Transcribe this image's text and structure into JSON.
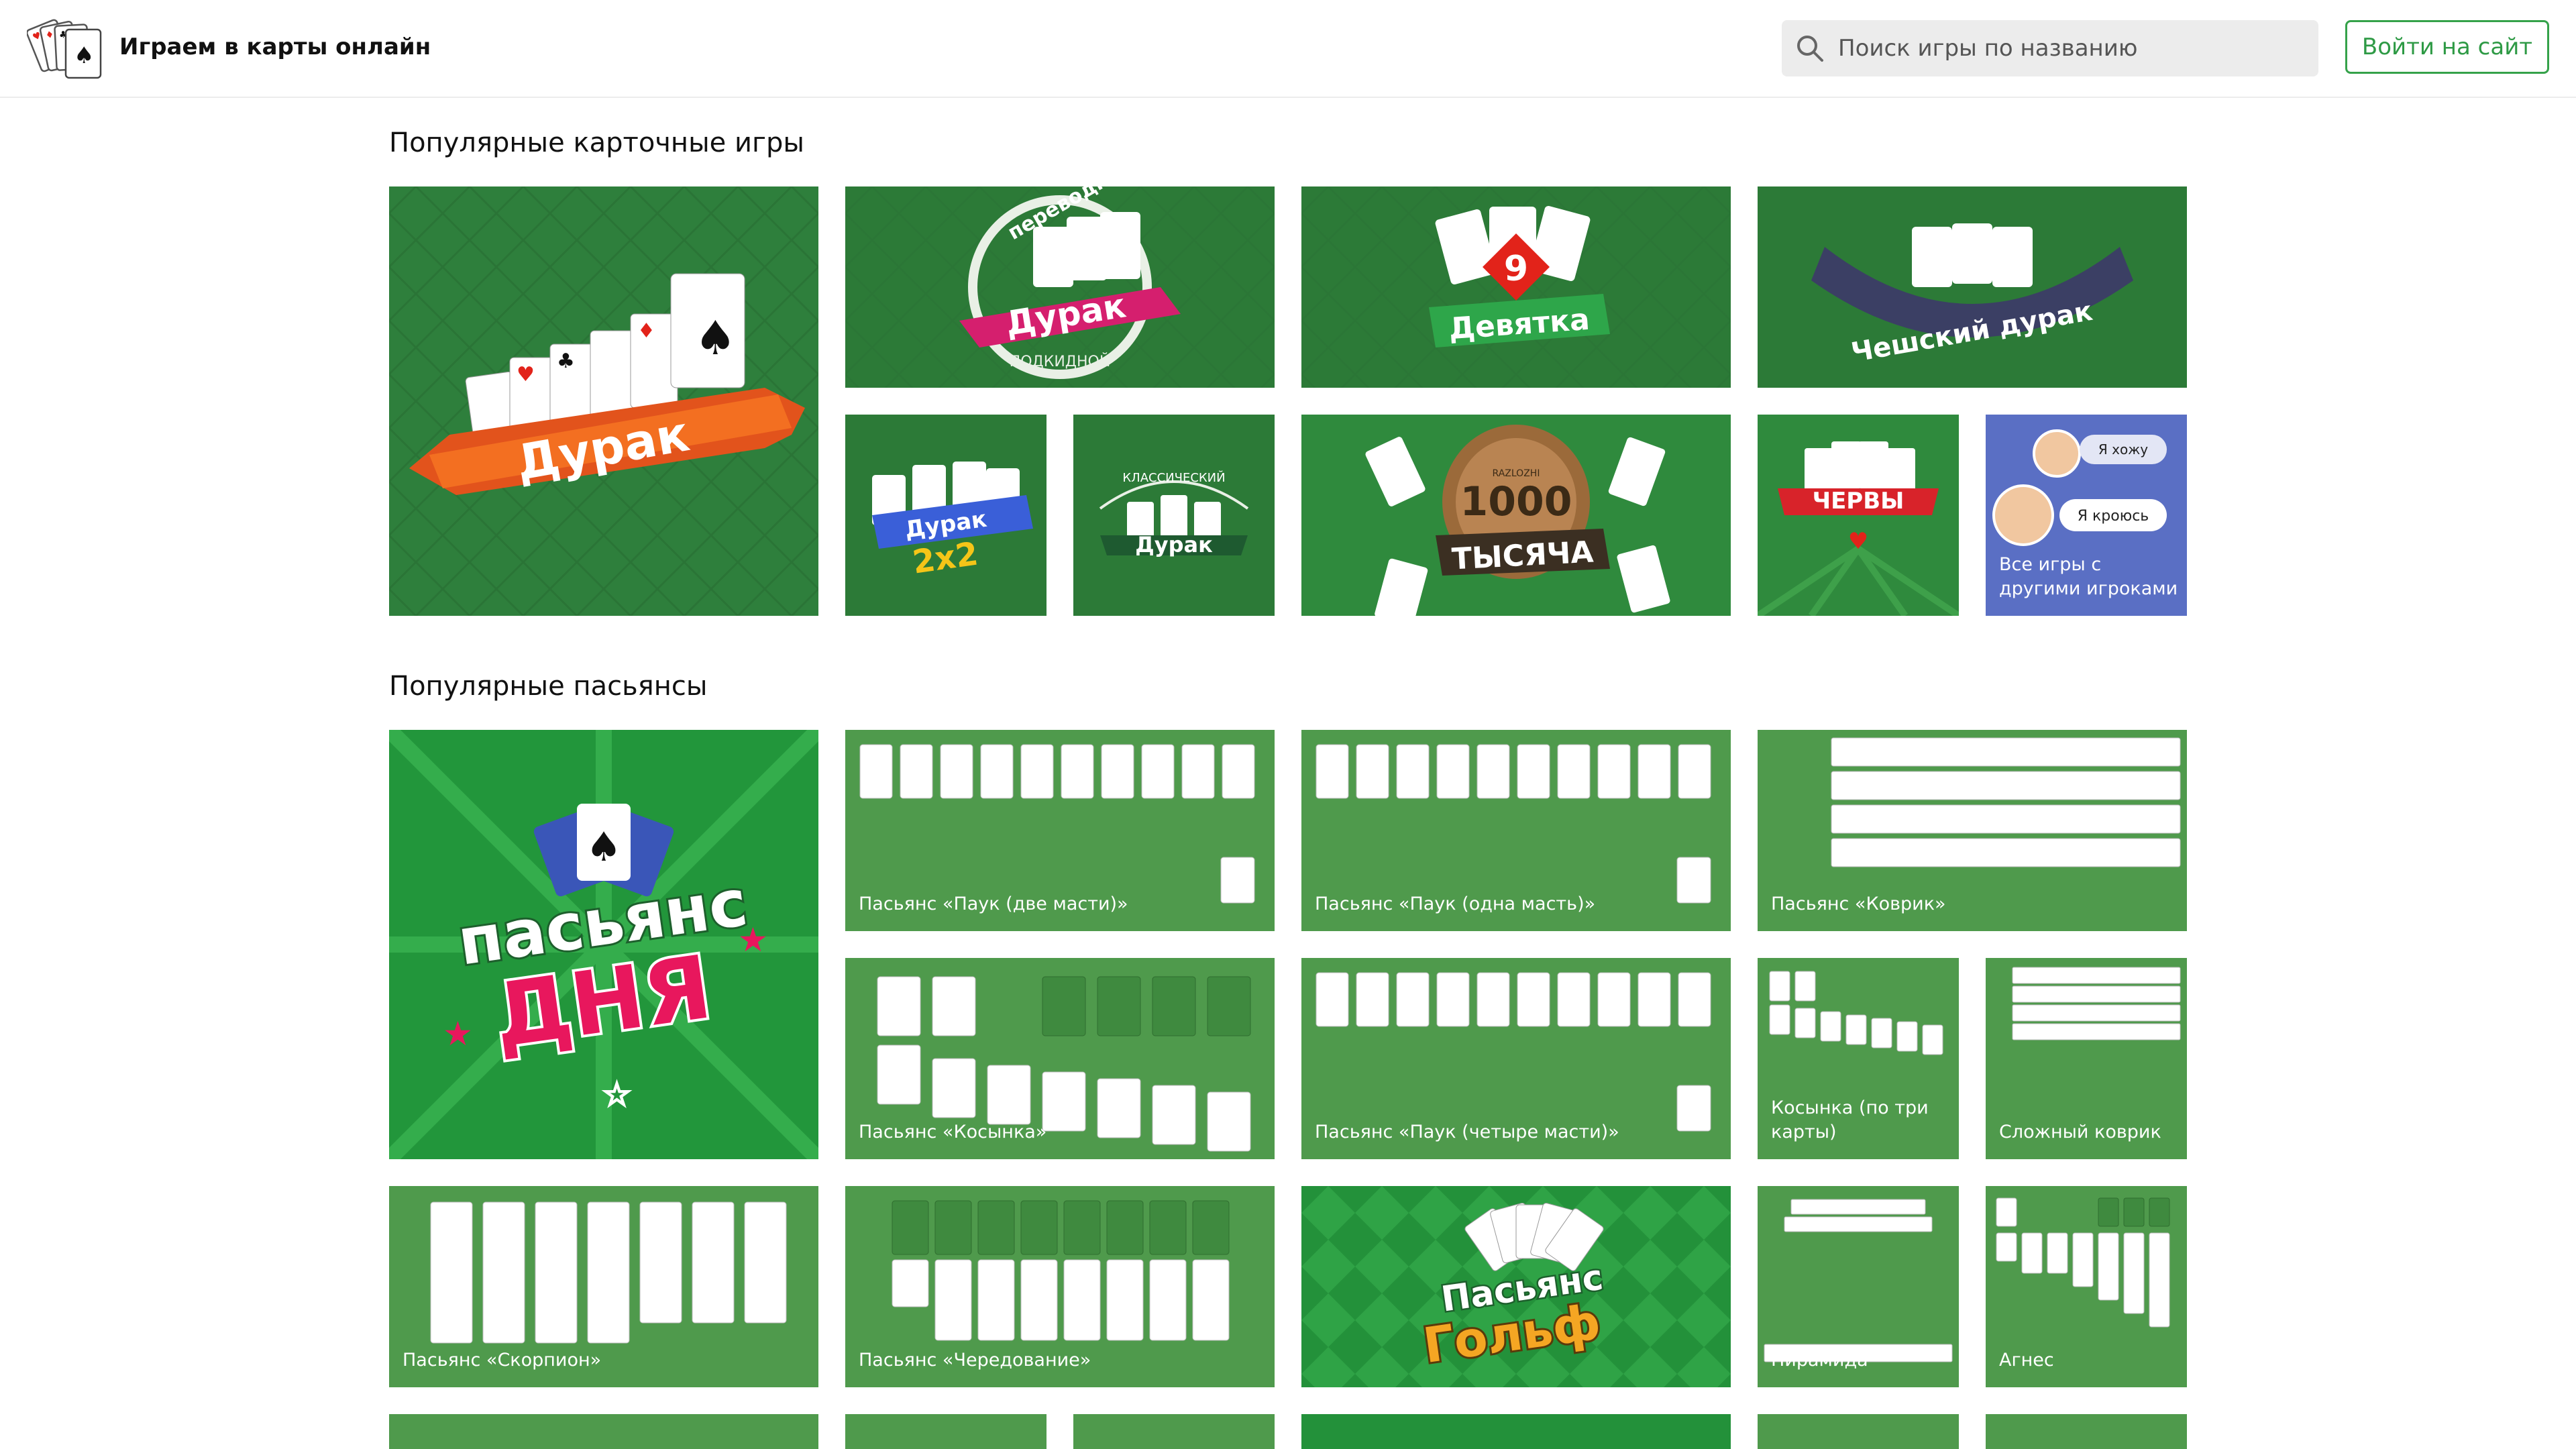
{
  "header": {
    "site_title": "Играем в карты онлайн",
    "search_placeholder": "Поиск игры по названию",
    "login_label": "Войти на сайт"
  },
  "card_games": {
    "title": "Популярные карточные игры",
    "tiles": [
      {
        "id": "durak",
        "banner": "Дурак"
      },
      {
        "id": "perevodnoy",
        "badge": "переводной",
        "badge_bottom": "ПОДКИДНОЙ",
        "banner": "Дурак"
      },
      {
        "id": "devyatka",
        "number": "9",
        "banner": "Девятка"
      },
      {
        "id": "cheshsky",
        "banner": "Чешский дурак"
      },
      {
        "id": "durak2x2",
        "banner": "Дурак",
        "sub": "2x2"
      },
      {
        "id": "classic",
        "badge": "КЛАССИЧЕСКИЙ",
        "banner": "Дурак"
      },
      {
        "id": "tysyacha",
        "small": "RAZLOZHI",
        "number": "1000",
        "banner": "ТЫСЯЧА"
      },
      {
        "id": "chervy",
        "banner": "ЧЕРВЫ"
      },
      {
        "id": "all-online",
        "bubble1": "Я хожу",
        "bubble2": "Я кроюсь",
        "label": "Все игры с другими игроками"
      }
    ]
  },
  "solitaires": {
    "title": "Популярные пасьянсы",
    "tiles": [
      {
        "id": "daily",
        "line1": "пасьянс",
        "line2": "ДНЯ"
      },
      {
        "id": "spider2",
        "label": "Пасьянс «Паук (две масти)»"
      },
      {
        "id": "spider1",
        "label": "Пасьянс «Паук (одна масть)»"
      },
      {
        "id": "kovrik",
        "label": "Пасьянс «Коврик»"
      },
      {
        "id": "kosynka",
        "label": "Пасьянс «Косынка»"
      },
      {
        "id": "spider4",
        "label": "Пасьянс «Паук (четыре масти)»"
      },
      {
        "id": "kosynka3",
        "label": "Косынка (по три карты)"
      },
      {
        "id": "hard-kovrik",
        "label": "Сложный коврик"
      },
      {
        "id": "scorpion",
        "label": "Пасьянс «Скорпион»"
      },
      {
        "id": "alternation",
        "label": "Пасьянс «Чередование»"
      },
      {
        "id": "golf",
        "line1": "Пасьянс",
        "line2": "Гольф"
      },
      {
        "id": "pyramid",
        "label": "Пирамида"
      },
      {
        "id": "agnes",
        "label": "Агнес"
      }
    ]
  },
  "colors": {
    "brand_green": "#35a24a",
    "tile_dark": "#2d7d3a",
    "tile_solitaire": "#4f9a4c",
    "banner_orange": "#f36f21",
    "banner_pink": "#d51f6e",
    "banner_blue": "#3a5fd8",
    "banner_navy": "#3b3f64",
    "online_bg": "#5a6fc4"
  }
}
